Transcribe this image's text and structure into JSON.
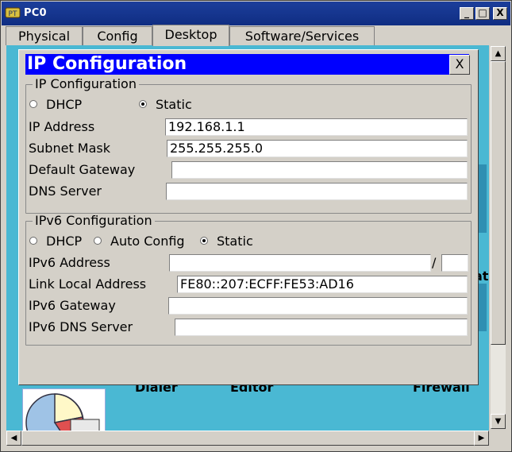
{
  "window": {
    "title": "PC0",
    "buttons": {
      "minimize": "_",
      "maximize": "□",
      "close": "X"
    }
  },
  "tabs": [
    {
      "label": "Physical"
    },
    {
      "label": "Config"
    },
    {
      "label": "Desktop",
      "active": true
    },
    {
      "label": "Software/Services"
    }
  ],
  "desktop": {
    "labels": [
      "Dialer",
      "Editor",
      "Firewall"
    ],
    "partial_label": "ato"
  },
  "dialog": {
    "title": "IP Configuration",
    "close_label": "X",
    "ipv4": {
      "legend": "IP Configuration",
      "dhcp_label": "DHCP",
      "static_label": "Static",
      "selected": "Static",
      "fields": {
        "ip_label": "IP Address",
        "ip_value": "192.168.1.1",
        "mask_label": "Subnet Mask",
        "mask_value": "255.255.255.0",
        "gateway_label": "Default Gateway",
        "gateway_value": "",
        "dns_label": "DNS Server",
        "dns_value": ""
      }
    },
    "ipv6": {
      "legend": "IPv6 Configuration",
      "dhcp_label": "DHCP",
      "auto_label": "Auto Config",
      "static_label": "Static",
      "selected": "Static",
      "fields": {
        "addr_label": "IPv6 Address",
        "addr_value": "",
        "prefix_sep": "/",
        "prefix_value": "",
        "link_local_label": "Link Local Address",
        "link_local_value": "FE80::207:ECFF:FE53:AD16",
        "gateway_label": "IPv6 Gateway",
        "gateway_value": "",
        "dns_label": "IPv6 DNS Server",
        "dns_value": ""
      }
    }
  },
  "scrollbars": {
    "up": "▲",
    "down": "▼",
    "left": "◀",
    "right": "▶"
  },
  "colors": {
    "titlebar": "#0f2d82",
    "dialog_title": "#0000ff",
    "desktop_bg": "#4ab8d3",
    "panel": "#d4d0c8"
  }
}
